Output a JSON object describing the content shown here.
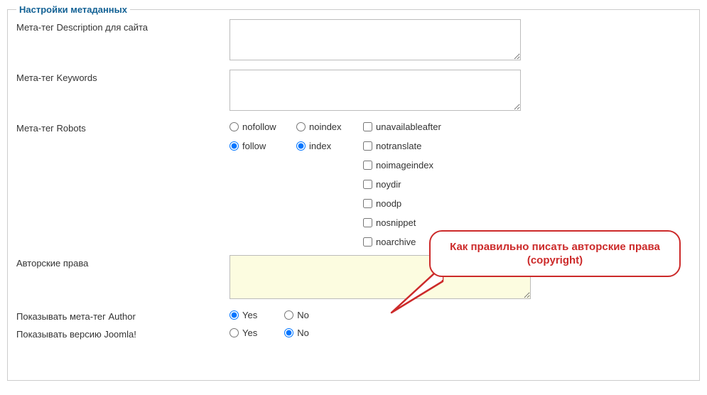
{
  "fieldset_title": "Настройки метаданных",
  "rows": {
    "meta_description_label": "Мета-тег Description для сайта",
    "meta_keywords_label": "Мета-тег Keywords",
    "meta_robots_label": "Мета-тег Robots",
    "copyright_label": "Авторские права",
    "show_author_label": "Показывать мета-тег Author",
    "show_joomla_label": "Показывать версию Joomla!"
  },
  "robots": {
    "col1": [
      {
        "label": "nofollow",
        "checked": false
      },
      {
        "label": "follow",
        "checked": true
      }
    ],
    "col2": [
      {
        "label": "noindex",
        "checked": false
      },
      {
        "label": "index",
        "checked": true
      }
    ],
    "col3": [
      {
        "label": "unavailableafter",
        "checked": false
      },
      {
        "label": "notranslate",
        "checked": false
      },
      {
        "label": "noimageindex",
        "checked": false
      },
      {
        "label": "noydir",
        "checked": false
      },
      {
        "label": "noodp",
        "checked": false
      },
      {
        "label": "nosnippet",
        "checked": false
      },
      {
        "label": "noarchive",
        "checked": false
      }
    ]
  },
  "yesno": {
    "yes": "Yes",
    "no": "No"
  },
  "show_author_value": "yes",
  "show_joomla_value": "no",
  "callout_text": "Как правильно писать авторские права (copyright)"
}
